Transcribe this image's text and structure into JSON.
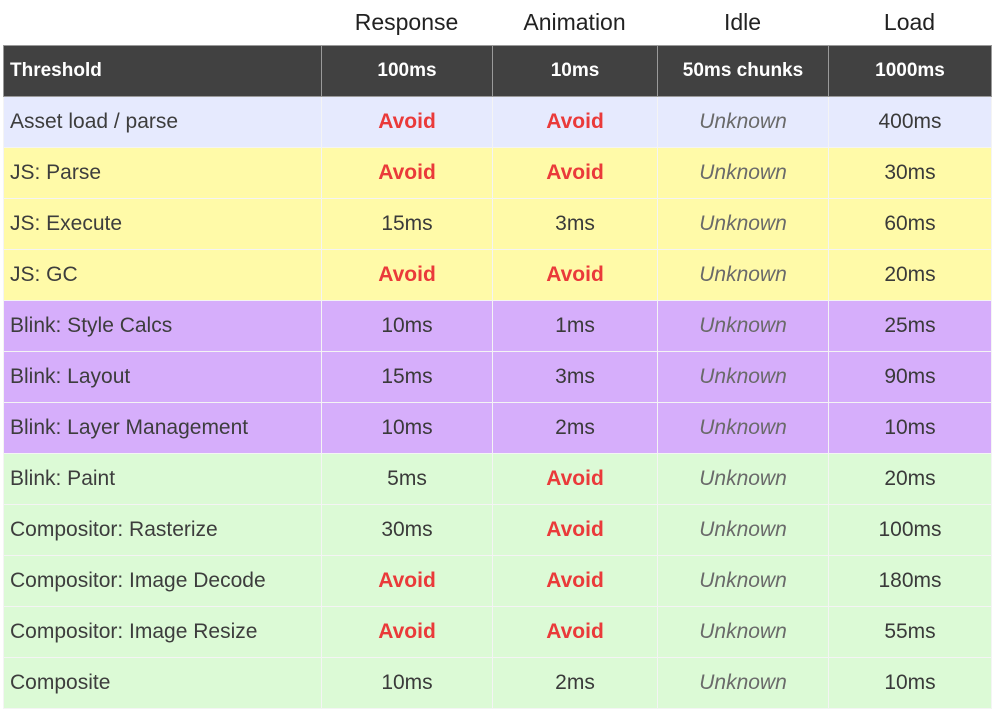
{
  "column_groups": [
    "",
    "Response",
    "Animation",
    "Idle",
    "Load"
  ],
  "header": {
    "label": "Threshold",
    "values": [
      "100ms",
      "10ms",
      "50ms chunks",
      "1000ms"
    ]
  },
  "colors": {
    "header_bg": "#414141",
    "avoid_text": "#ea3a3a",
    "group_asset": "#e6eafe",
    "group_js": "#fffaa8",
    "group_blink": "#d6aefb",
    "group_compositor": "#dcfad6"
  },
  "rows": [
    {
      "group": "asset",
      "label": "Asset load / parse",
      "cells": [
        "Avoid",
        "Avoid",
        "Unknown",
        "400ms"
      ]
    },
    {
      "group": "js",
      "label": "JS: Parse",
      "cells": [
        "Avoid",
        "Avoid",
        "Unknown",
        "30ms"
      ]
    },
    {
      "group": "js",
      "label": "JS: Execute",
      "cells": [
        "15ms",
        "3ms",
        "Unknown",
        "60ms"
      ]
    },
    {
      "group": "js",
      "label": "JS: GC",
      "cells": [
        "Avoid",
        "Avoid",
        "Unknown",
        "20ms"
      ]
    },
    {
      "group": "blink",
      "label": "Blink: Style Calcs",
      "cells": [
        "10ms",
        "1ms",
        "Unknown",
        "25ms"
      ]
    },
    {
      "group": "blink",
      "label": "Blink: Layout",
      "cells": [
        "15ms",
        "3ms",
        "Unknown",
        "90ms"
      ]
    },
    {
      "group": "blink",
      "label": "Blink: Layer Management",
      "cells": [
        "10ms",
        "2ms",
        "Unknown",
        "10ms"
      ]
    },
    {
      "group": "comp",
      "label": "Blink: Paint",
      "cells": [
        "5ms",
        "Avoid",
        "Unknown",
        "20ms"
      ]
    },
    {
      "group": "comp",
      "label": "Compositor: Rasterize",
      "cells": [
        "30ms",
        "Avoid",
        "Unknown",
        "100ms"
      ]
    },
    {
      "group": "comp",
      "label": "Compositor: Image Decode",
      "cells": [
        "Avoid",
        "Avoid",
        "Unknown",
        "180ms"
      ]
    },
    {
      "group": "comp",
      "label": "Compositor: Image Resize",
      "cells": [
        "Avoid",
        "Avoid",
        "Unknown",
        "55ms"
      ]
    },
    {
      "group": "comp",
      "label": "Composite",
      "cells": [
        "10ms",
        "2ms",
        "Unknown",
        "10ms"
      ]
    }
  ]
}
